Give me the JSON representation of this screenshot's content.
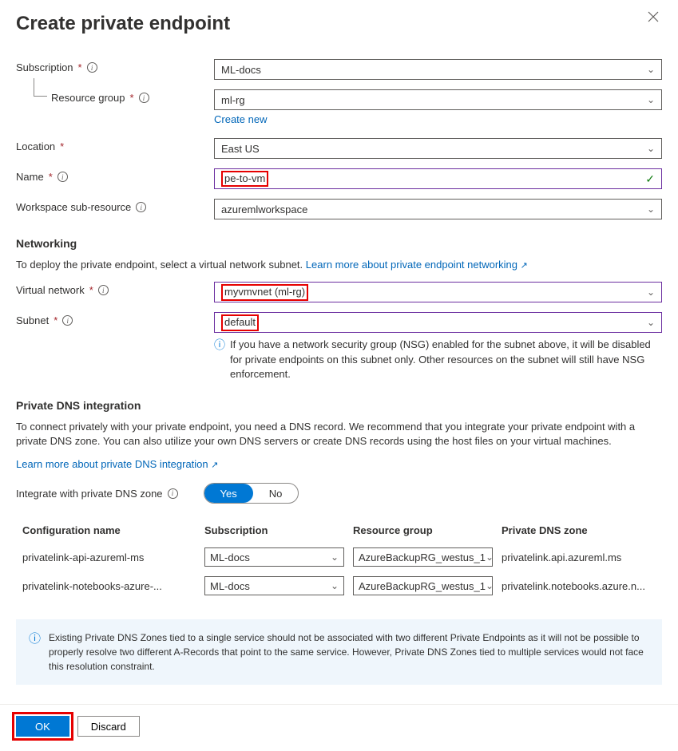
{
  "header": {
    "title": "Create private endpoint"
  },
  "labels": {
    "subscription": "Subscription",
    "resource_group": "Resource group",
    "location": "Location",
    "name": "Name",
    "sub_resource": "Workspace sub-resource",
    "virtual_network": "Virtual network",
    "subnet": "Subnet",
    "integrate_dns": "Integrate with private DNS zone"
  },
  "values": {
    "subscription": "ML-docs",
    "resource_group": "ml-rg",
    "location": "East US",
    "name": "pe-to-vm",
    "sub_resource": "azuremlworkspace",
    "virtual_network": "myvmvnet (ml-rg)",
    "subnet": "default"
  },
  "links": {
    "create_new": "Create new",
    "learn_pe": "Learn more about private endpoint networking",
    "learn_dns": "Learn more about private DNS integration"
  },
  "sections": {
    "networking": "Networking",
    "dns": "Private DNS integration"
  },
  "text": {
    "networking_desc": "To deploy the private endpoint, select a virtual network subnet.",
    "nsg_info": "If you have a network security group (NSG) enabled for the subnet above, it will be disabled for private endpoints on this subnet only. Other resources on the subnet will still have NSG enforcement.",
    "dns_desc": "To connect privately with your private endpoint, you need a DNS record. We recommend that you integrate your private endpoint with a private DNS zone. You can also utilize your own DNS servers or create DNS records using the host files on your virtual machines.",
    "dns_warning": "Existing Private DNS Zones tied to a single service should not be associated with two different Private Endpoints as it will not be possible to properly resolve two different A-Records that point to the same service. However, Private DNS Zones tied to multiple services would not face this resolution constraint."
  },
  "toggle": {
    "yes": "Yes",
    "no": "No"
  },
  "table": {
    "headers": {
      "config": "Configuration name",
      "sub": "Subscription",
      "rg": "Resource group",
      "zone": "Private DNS zone"
    },
    "rows": [
      {
        "config": "privatelink-api-azureml-ms",
        "sub": "ML-docs",
        "rg": "AzureBackupRG_westus_1",
        "zone": "privatelink.api.azureml.ms"
      },
      {
        "config": "privatelink-notebooks-azure-...",
        "sub": "ML-docs",
        "rg": "AzureBackupRG_westus_1",
        "zone": "privatelink.notebooks.azure.n..."
      }
    ]
  },
  "buttons": {
    "ok": "OK",
    "discard": "Discard"
  }
}
